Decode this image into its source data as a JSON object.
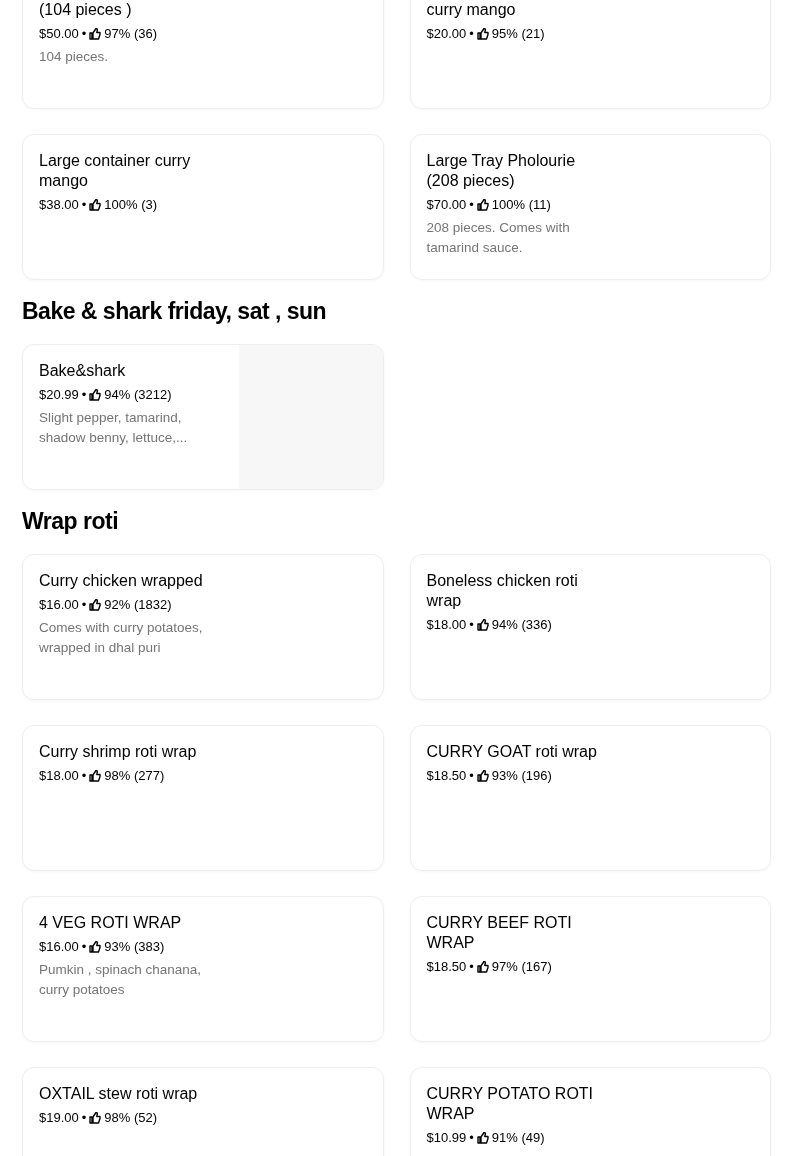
{
  "sections": [
    {
      "items": [
        {
          "title": "(104 pieces )",
          "price": "$50.00",
          "separator": "•",
          "rating": "97% (36)",
          "description": "104 pieces."
        },
        {
          "title": "curry mango",
          "price": "$20.00",
          "separator": "•",
          "rating": "95% (21)"
        },
        {
          "title": "Large container curry mango",
          "price": "$38.00",
          "separator": "•",
          "rating": "100% (3)"
        },
        {
          "title": "Large Tray Pholourie (208 pieces)",
          "price": "$70.00",
          "separator": "•",
          "rating": "100% (11)",
          "description": "208 pieces. Comes with tamarind sauce."
        }
      ]
    },
    {
      "title": "Bake & shark friday, sat , sun",
      "items": [
        {
          "title": "Bake&shark",
          "price": "$20.99",
          "separator": "•",
          "rating": "94% (3212)",
          "description": "Slight pepper, tamarind, shadow benny, lettuce,...",
          "image": true
        }
      ]
    },
    {
      "title": "Wrap roti",
      "items": [
        {
          "title": "Curry chicken  wrapped",
          "price": "$16.00",
          "separator": "•",
          "rating": "92% (1832)",
          "description": "Comes with curry potatoes, wrapped in dhal puri"
        },
        {
          "title": "Boneless chicken roti wrap",
          "price": "$18.00",
          "separator": "•",
          "rating": "94% (336)"
        },
        {
          "title": "Curry shrimp roti wrap",
          "price": "$18.00",
          "separator": "•",
          "rating": "98% (277)"
        },
        {
          "title": "CURRY GOAT roti wrap",
          "price": "$18.50",
          "separator": "•",
          "rating": "93% (196)"
        },
        {
          "title": "4 VEG ROTI WRAP",
          "price": "$16.00",
          "separator": "•",
          "rating": "93% (383)",
          "description": "Pumkin , spinach chanana, curry potatoes"
        },
        {
          "title": "CURRY BEEF ROTI WRAP",
          "price": "$18.50",
          "separator": "•",
          "rating": "97% (167)"
        },
        {
          "title": "OXTAIL stew roti wrap",
          "price": "$19.00",
          "separator": "•",
          "rating": "98% (52)"
        },
        {
          "title": "CURRY POTATO ROTI WRAP",
          "price": "$10.99",
          "separator": "•",
          "rating": "91% (49)"
        }
      ]
    }
  ]
}
